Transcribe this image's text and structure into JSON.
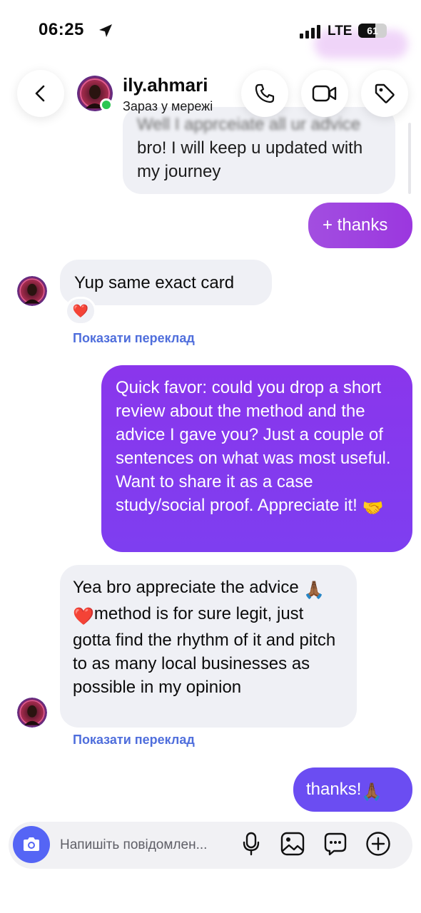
{
  "status_bar": {
    "time": "06:25",
    "network": "LTE",
    "battery_level": "61",
    "battery_fraction": 0.61
  },
  "header": {
    "username": "ily.ahmari",
    "presence": "Зараз у мережі",
    "online_color": "#2bc653",
    "icons": [
      "back-icon",
      "phone-icon",
      "video-icon",
      "tag-icon"
    ]
  },
  "messages": [
    {
      "sender": "me",
      "text_line1": "Well I apprceiate all ur advice",
      "text_rest": "bro! I will keep u updated with my journey"
    },
    {
      "sender": "me",
      "text": "+ thanks"
    },
    {
      "sender": "them",
      "text": "Yup same exact card",
      "reaction": "❤️",
      "translate": "Показати переклад"
    },
    {
      "sender": "me",
      "text_main": "Quick favor: could you drop a short review about the method and the advice I gave you? Just a couple of sentences on what was most useful. Want to share it as a case study/social proof. Appreciate it!",
      "emoji": "🤝"
    },
    {
      "sender": "them",
      "text_before": "Yea bro appreciate the advice",
      "emoji_1": "🙏🏾",
      "emoji_2": "❤️",
      "text_after": "method is for sure legit, just gotta find the rhythm of it and pitch to as many local businesses as possible in my opinion",
      "translate": "Показати переклад"
    },
    {
      "sender": "me",
      "text": "thanks!",
      "emoji": "🙏🏾"
    }
  ],
  "composer": {
    "placeholder": "Напишіть повідомлен...",
    "icons": [
      "camera-icon",
      "microphone-icon",
      "gallery-icon",
      "sticker-icon",
      "plus-icon"
    ]
  },
  "colors": {
    "accent_purple": "#8a36ec",
    "accent_blue": "#6b4df2",
    "incoming_bubble": "#eff0f5",
    "translate_link": "#4f6edc",
    "camera_button": "#5565f5"
  }
}
